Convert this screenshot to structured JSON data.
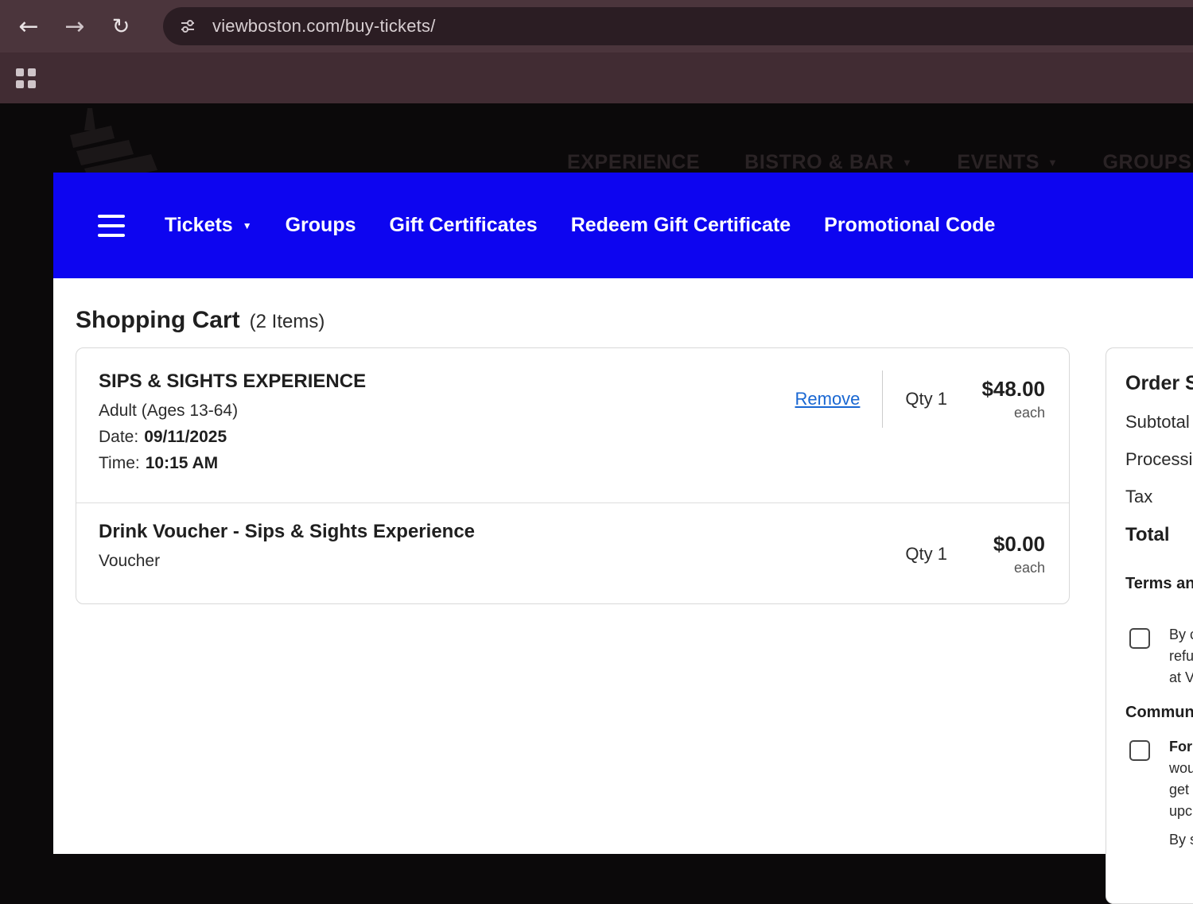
{
  "colors": {
    "accent": "#0d05f0",
    "link": "#1967d2"
  },
  "icons": {
    "back": "←",
    "forward": "→",
    "reload": "↻",
    "chevron_down": "▼"
  },
  "browser": {
    "url": "viewboston.com/buy-tickets/"
  },
  "site_nav": {
    "items": [
      {
        "label": "EXPERIENCE"
      },
      {
        "label": "BISTRO & BAR"
      },
      {
        "label": "EVENTS"
      },
      {
        "label": "GROUPS"
      }
    ]
  },
  "ticket_nav": {
    "items": [
      "Tickets",
      "Groups",
      "Gift Certificates",
      "Redeem Gift Certificate",
      "Promotional Code"
    ]
  },
  "cart": {
    "title": "Shopping Cart",
    "count": "(2 Items)",
    "items": [
      {
        "name": "SIPS & SIGHTS EXPERIENCE",
        "variant": "Adult (Ages 13-64)",
        "date_label": "Date:",
        "date_value": "09/11/2025",
        "time_label": "Time:",
        "time_value": "10:15 AM",
        "remove_label": "Remove",
        "qty_label": "Qty 1",
        "price": "$48.00",
        "price_unit": "each"
      },
      {
        "name": "Drink Voucher - Sips & Sights Experience",
        "variant": "Voucher",
        "qty_label": "Qty 1",
        "price": "$0.00",
        "price_unit": "each"
      }
    ]
  },
  "order_summary": {
    "title": "Order S",
    "line_subtotal": "Subtotal",
    "line_processing": "Processi",
    "line_tax": "Tax",
    "total_label": "Total",
    "terms_heading": "Terms an",
    "terms_lines": [
      "By c",
      "refu",
      "at V"
    ],
    "comm_heading": "Commun",
    "comm_line_bold": "For",
    "comm_lines": [
      "wou",
      "get",
      "upc"
    ],
    "footer_line": "By s"
  }
}
